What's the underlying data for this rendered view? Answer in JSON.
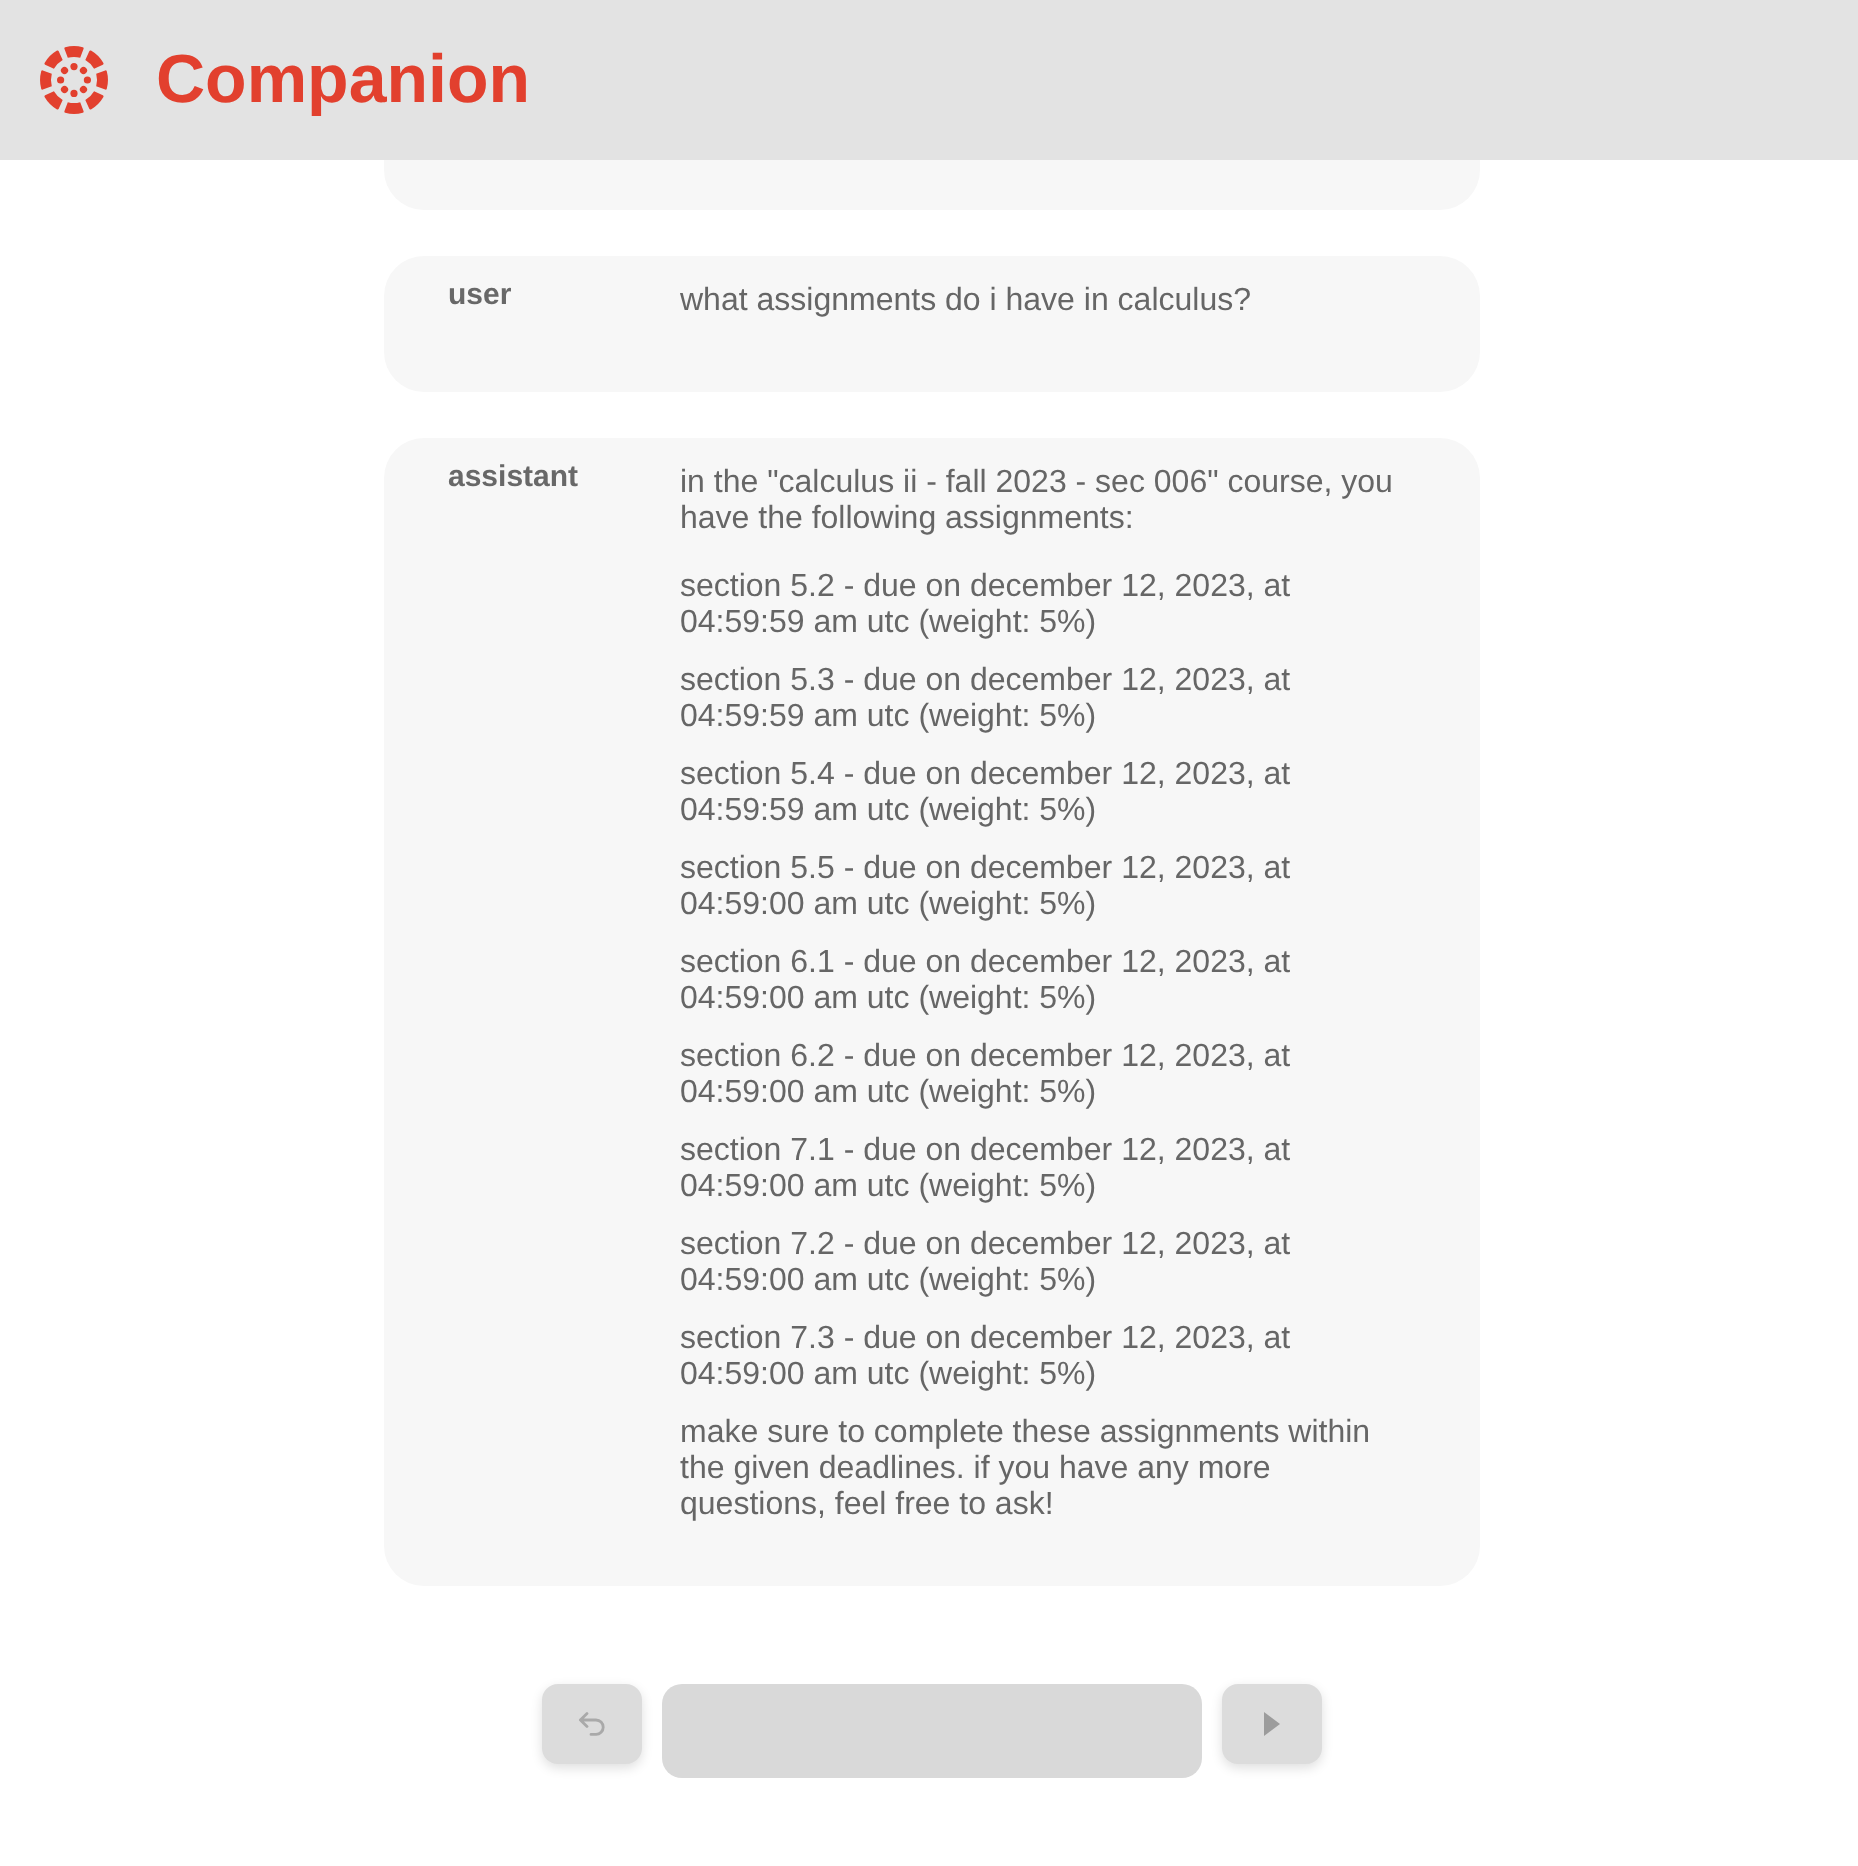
{
  "app": {
    "title": "Companion"
  },
  "messages": [
    {
      "kind": "clipped"
    },
    {
      "kind": "full",
      "role": "user",
      "paragraphs": [
        "what assignments do i have in calculus?"
      ]
    },
    {
      "kind": "full",
      "role": "assistant",
      "paragraphs": [
        "in the \"calculus ii - fall 2023 - sec 006\" course, you have the following assignments:",
        "section 5.2 - due on december 12, 2023, at 04:59:59 am utc (weight: 5%)",
        "section 5.3 - due on december 12, 2023, at 04:59:59 am utc (weight: 5%)",
        "section 5.4 - due on december 12, 2023, at 04:59:59 am utc (weight: 5%)",
        "section 5.5 - due on december 12, 2023, at 04:59:00 am utc (weight: 5%)",
        "section 6.1 - due on december 12, 2023, at 04:59:00 am utc (weight: 5%)",
        "section 6.2 - due on december 12, 2023, at 04:59:00 am utc (weight: 5%)",
        "section 7.1 - due on december 12, 2023, at 04:59:00 am utc (weight: 5%)",
        "section 7.2 - due on december 12, 2023, at 04:59:00 am utc (weight: 5%)",
        "section 7.3 - due on december 12, 2023, at 04:59:00 am utc (weight: 5%)",
        "make sure to complete these assignments within the given deadlines. if you have any more questions, feel free to ask!"
      ]
    }
  ],
  "composer": {
    "controls": [
      {
        "kind": "undo"
      },
      {
        "kind": "input"
      },
      {
        "kind": "send"
      }
    ]
  }
}
